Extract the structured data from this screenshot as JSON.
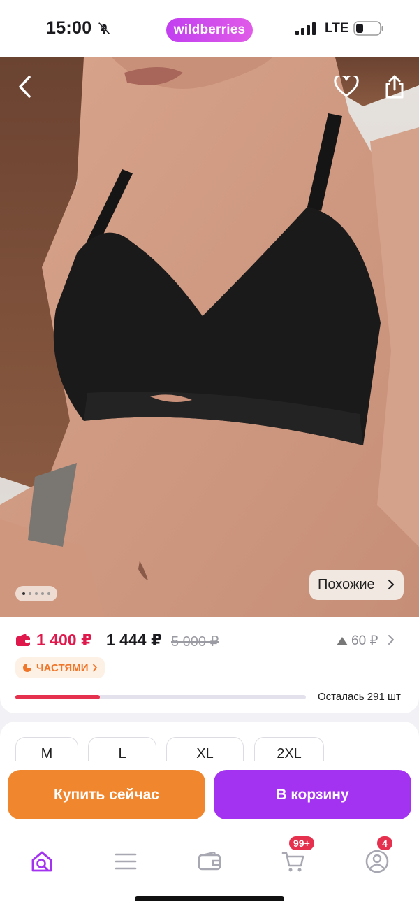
{
  "status_bar": {
    "time": "15:00",
    "network": "LTE",
    "icons": [
      "bell-off-icon",
      "signal-icon",
      "battery-icon"
    ]
  },
  "brand": {
    "name": "wildberries",
    "color": "#cb4ded"
  },
  "photo": {
    "slide_count": 5,
    "active_slide": 1,
    "similar_label": "Похожие",
    "icons": [
      "chevron-left-icon",
      "heart-icon",
      "share-icon",
      "chevron-right-icon"
    ]
  },
  "price": {
    "wallet_price": "1 400 ₽",
    "price": "1 444 ₽",
    "old_price": "5 000 ₽",
    "price_change": "60 ₽",
    "installment_label": "ЧАСТЯМИ",
    "stock_label": "Осталась 291 шт",
    "stock_fraction": 0.29,
    "accent_color": "#e0194d"
  },
  "sizes": [
    "M",
    "L",
    "XL",
    "2XL"
  ],
  "actions": {
    "buy_now": "Купить сейчас",
    "add_to_cart": "В корзину",
    "buy_now_color": "#f0872f",
    "add_to_cart_color": "#a333f0"
  },
  "tab_bar": {
    "items": [
      {
        "icon": "home-search-icon",
        "active": true
      },
      {
        "icon": "menu-icon"
      },
      {
        "icon": "wallet-icon"
      },
      {
        "icon": "cart-icon",
        "badge": "99+"
      },
      {
        "icon": "profile-icon",
        "badge": "4"
      }
    ]
  }
}
